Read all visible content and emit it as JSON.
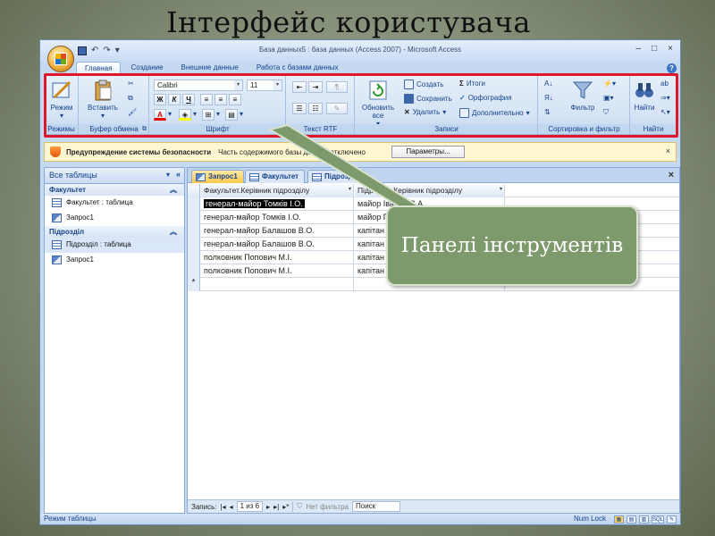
{
  "slide": {
    "title": "Інтерфейс користувача",
    "callout": "Панелі інструментів"
  },
  "window": {
    "title": "База данных5 : база данных (Access 2007) - Microsoft Access",
    "controls": [
      "–",
      "□",
      "×"
    ]
  },
  "ribbon": {
    "tabs": [
      {
        "label": "Главная",
        "active": true
      },
      {
        "label": "Создание",
        "active": false
      },
      {
        "label": "Внешние данные",
        "active": false
      },
      {
        "label": "Работа с базами данных",
        "active": false
      }
    ],
    "groups": {
      "views": {
        "label": "Режимы",
        "view_button": "Режим"
      },
      "clipboard": {
        "label": "Буфер обмена",
        "paste_button": "Вставить"
      },
      "font": {
        "label": "Шрифт",
        "font_name": "Calibri",
        "font_size": "11",
        "bold": "Ж",
        "italic": "К",
        "underline": "Ч",
        "font_color": "A"
      },
      "rtf": {
        "label": "Текст RTF"
      },
      "records": {
        "label": "Записи",
        "refresh_button": "Обновить все",
        "new": "Создать",
        "save": "Сохранить",
        "delete": "Удалить",
        "totals": "Итоги",
        "spelling": "Орфография",
        "more": "Дополнительно"
      },
      "sort_filter": {
        "label": "Сортировка и фильтр",
        "filter_button": "Фильтр"
      },
      "find": {
        "label": "Найти",
        "find_button": "Найти"
      }
    }
  },
  "security_bar": {
    "title": "Предупреждение системы безопасности",
    "message": "Часть содержимого базы данных отключено",
    "options_button": "Параметры..."
  },
  "nav_pane": {
    "header": "Все таблицы",
    "sections": [
      {
        "name": "Факультет",
        "items": [
          "Факультет : таблица",
          "Запрос1"
        ]
      },
      {
        "name": "Підрозділ",
        "items": [
          "Підрозділ : таблица",
          "Запрос1"
        ]
      }
    ]
  },
  "document": {
    "tabs": [
      "Запрос1",
      "Факультет",
      "Підрозділ"
    ],
    "columns": [
      "Факультет.Керівник підрозділу",
      "Підрозділ.Керівник підрозділу"
    ],
    "rows": [
      [
        "генерал-майор Томків І.О.",
        "майор Іванов С.А."
      ],
      [
        "генерал-майор Томків І.О.",
        "майор Петренко"
      ],
      [
        "генерал-майор Балашов В.О.",
        "капітан"
      ],
      [
        "генерал-майор Балашов В.О.",
        "капітан"
      ],
      [
        "полковник Попович М.І.",
        "капітан"
      ],
      [
        "полковник Попович М.І.",
        "капітан"
      ]
    ],
    "record_bar": {
      "label": "Запись:",
      "position": "1 из 6",
      "filter": "Нет фильтра",
      "search": "Поиск"
    }
  },
  "status_bar": {
    "mode": "Режим таблицы",
    "numlock": "Num Lock",
    "view_sql": "SQL"
  },
  "colors": {
    "highlight_box": "#e0172b",
    "callout_fill": "#7d9a6c",
    "active_tab": "#ffc94a"
  }
}
